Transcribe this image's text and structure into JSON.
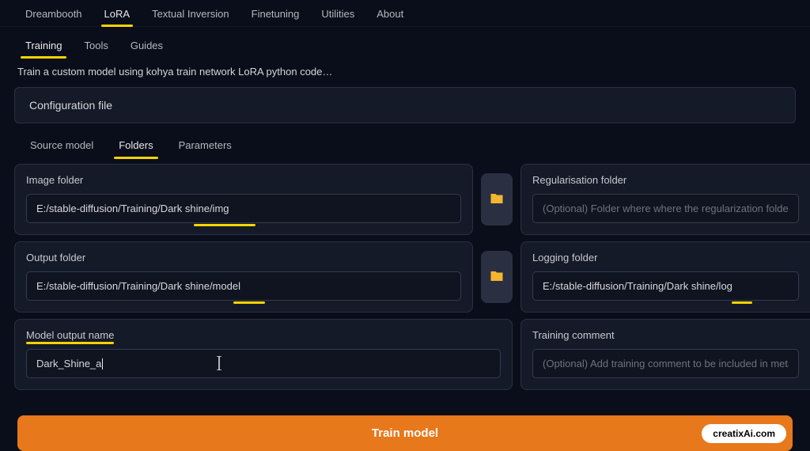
{
  "top_tabs": {
    "dreambooth": "Dreambooth",
    "lora": "LoRA",
    "textual": "Textual Inversion",
    "finetuning": "Finetuning",
    "utilities": "Utilities",
    "about": "About"
  },
  "sub_tabs": {
    "training": "Training",
    "tools": "Tools",
    "guides": "Guides"
  },
  "description": "Train a custom model using kohya train network LoRA python code…",
  "config_label": "Configuration file",
  "inner_tabs": {
    "source_model": "Source model",
    "folders": "Folders",
    "parameters": "Parameters"
  },
  "fields": {
    "image_folder": {
      "label": "Image folder",
      "value": "E:/stable-diffusion/Training/Dark shine/img"
    },
    "regularisation_folder": {
      "label": "Regularisation folder",
      "placeholder": "(Optional) Folder where where the regularization folders containin"
    },
    "output_folder": {
      "label": "Output folder",
      "value": "E:/stable-diffusion/Training/Dark shine/model"
    },
    "logging_folder": {
      "label": "Logging folder",
      "value": "E:/stable-diffusion/Training/Dark shine/log"
    },
    "model_output_name": {
      "label": "Model output name",
      "value": "Dark_Shine_a"
    },
    "training_comment": {
      "label": "Training comment",
      "placeholder": "(Optional) Add training comment to be included in metadata"
    }
  },
  "train_button": "Train model",
  "watermark": "creatixAi.com"
}
